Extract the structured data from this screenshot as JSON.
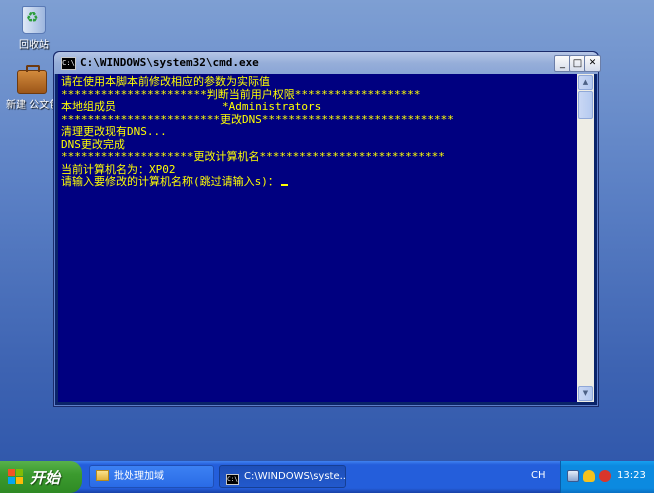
{
  "desktop": {
    "icons": [
      {
        "label": "回收站"
      },
      {
        "label": "新建 公文包"
      }
    ]
  },
  "window": {
    "title": "C:\\WINDOWS\\system32\\cmd.exe",
    "sys_icon": "C:\\",
    "buttons": {
      "minimize": "_",
      "maximize": "□",
      "close": "✕"
    }
  },
  "console": {
    "lines": [
      "请在使用本脚本前修改相应的参数为实际值",
      "**********************判断当前用户权限*******************",
      "本地组成员                *Administrators",
      "************************更改DNS*****************************",
      "清理更改现有DNS...",
      "DNS更改完成",
      "********************更改计算机名****************************",
      "当前计算机名为：XP02",
      "请输入要修改的计算机名称(跳过请输入s)："
    ]
  },
  "scrollbar": {
    "up": "▲",
    "down": "▼"
  },
  "taskbar": {
    "start_label": "开始",
    "tasks": [
      {
        "label": "批处理加域"
      },
      {
        "label": "C:\\WINDOWS\\syste..."
      }
    ],
    "language": "CH",
    "clock": "13:23",
    "flag_colors": [
      "#f35325",
      "#81bc06",
      "#05a6f0",
      "#ffba08"
    ]
  }
}
